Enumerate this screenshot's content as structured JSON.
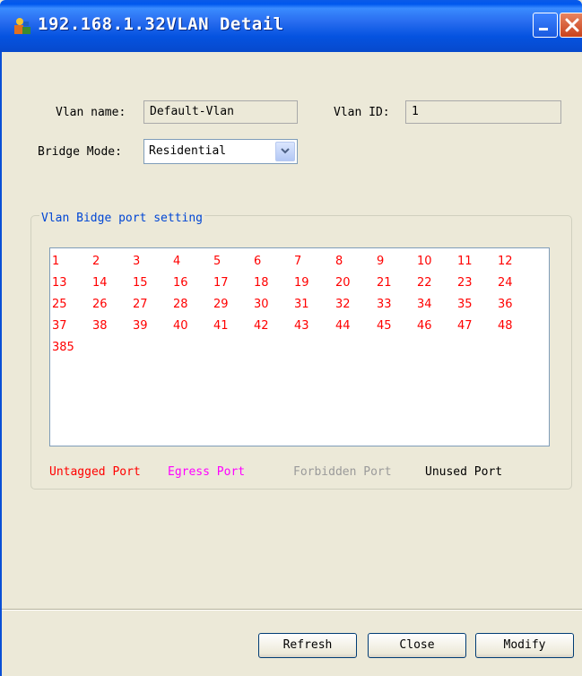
{
  "window": {
    "title": "192.168.1.32VLAN Detail"
  },
  "form": {
    "vlan_name_label": "Vlan name:",
    "vlan_name_value": "Default-Vlan",
    "vlan_id_label": "Vlan ID:",
    "vlan_id_value": "1",
    "bridge_mode_label": "Bridge Mode:",
    "bridge_mode_value": "Residential"
  },
  "port_setting": {
    "group_title": "Vlan Bidge port setting",
    "ports": [
      "1",
      "2",
      "3",
      "4",
      "5",
      "6",
      "7",
      "8",
      "9",
      "10",
      "11",
      "12",
      "13",
      "14",
      "15",
      "16",
      "17",
      "18",
      "19",
      "20",
      "21",
      "22",
      "23",
      "24",
      "25",
      "26",
      "27",
      "28",
      "29",
      "30",
      "31",
      "32",
      "33",
      "34",
      "35",
      "36",
      "37",
      "38",
      "39",
      "40",
      "41",
      "42",
      "43",
      "44",
      "45",
      "46",
      "47",
      "48",
      "385"
    ],
    "port_color": "#ff0000"
  },
  "legend": {
    "untagged": {
      "label": "Untagged Port",
      "color": "#ff0000"
    },
    "egress": {
      "label": "Egress Port",
      "color": "#ff00ff"
    },
    "forbidden": {
      "label": "Forbidden Port",
      "color": "#9a9a9a"
    },
    "unused": {
      "label": "Unused Port",
      "color": "#000000"
    }
  },
  "buttons": {
    "refresh": "Refresh",
    "close": "Close",
    "modify": "Modify"
  },
  "icons": {
    "app": "app-icon",
    "minimize": "minimize-icon",
    "close": "close-icon",
    "dropdown": "chevron-down-icon"
  }
}
